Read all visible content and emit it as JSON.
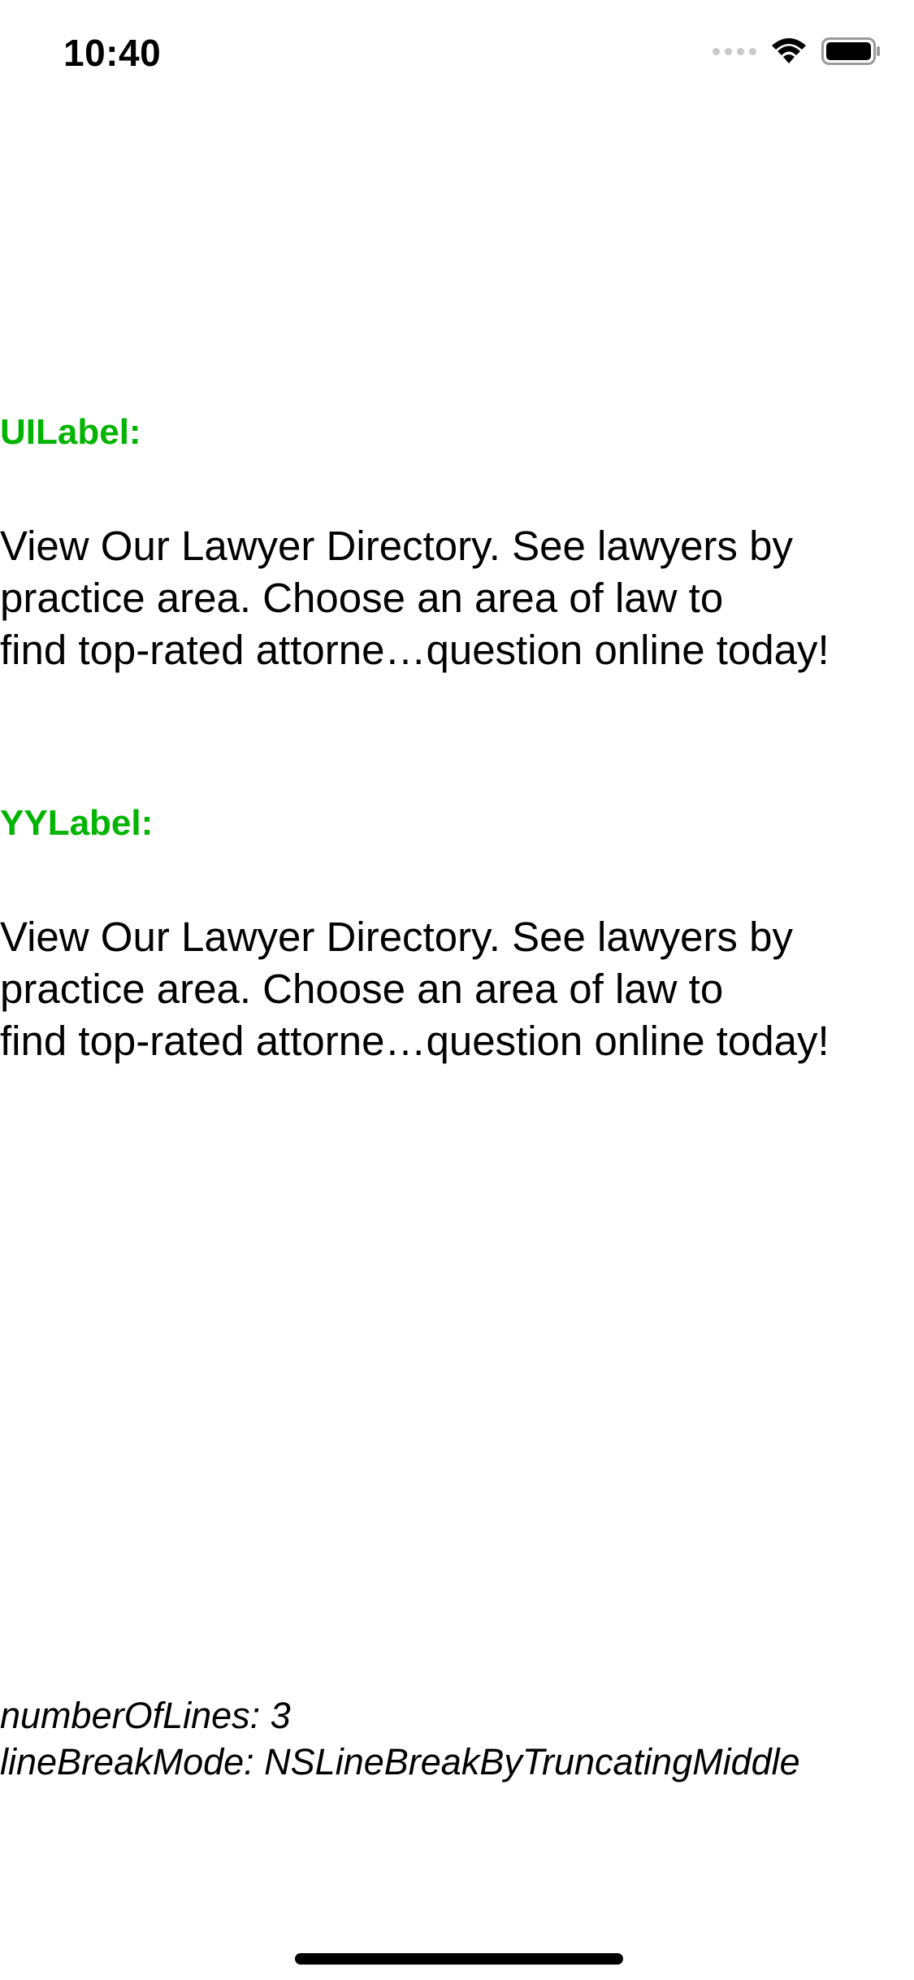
{
  "status_bar": {
    "time": "10:40",
    "icons": [
      "signal-dots-icon",
      "wifi-icon",
      "battery-icon"
    ]
  },
  "sections": [
    {
      "title": "UILabel:",
      "lines": [
        "View Our Lawyer Directory. See lawyers by",
        "practice area. Choose an area of law to",
        "find top-rated attorne…question online today!"
      ]
    },
    {
      "title": "YYLabel:",
      "lines": [
        "View Our Lawyer Directory. See lawyers by",
        "practice area. Choose an area of law to",
        "find top-rated attorne…question online today!"
      ]
    }
  ],
  "caption": {
    "number_of_lines": "numberOfLines: 3",
    "line_break_mode": "lineBreakMode: NSLineBreakByTruncatingMiddle"
  },
  "colors": {
    "title": "#00b400",
    "text": "#000000",
    "background": "#ffffff"
  }
}
